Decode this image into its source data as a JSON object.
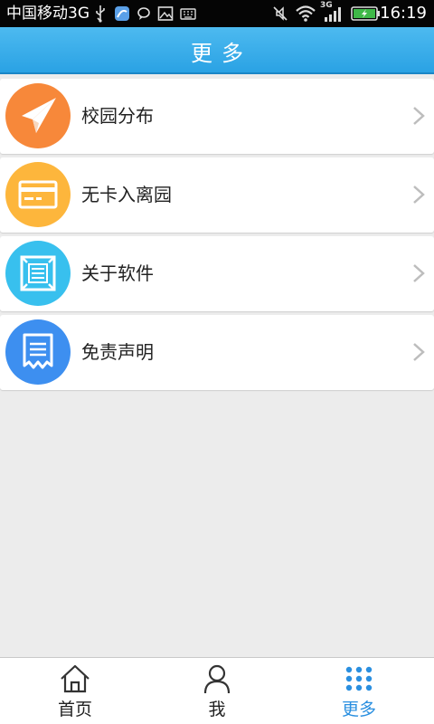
{
  "status_bar": {
    "carrier": "中国移动3G",
    "network": "3G",
    "time": "16:19"
  },
  "header": {
    "title": "更多"
  },
  "menu": {
    "items": [
      {
        "label": "校园分布",
        "icon": "paper-plane-icon",
        "color": "#f7883a"
      },
      {
        "label": "无卡入离园",
        "icon": "card-icon",
        "color": "#fdb63c"
      },
      {
        "label": "关于软件",
        "icon": "info-frame-icon",
        "color": "#38c0ee"
      },
      {
        "label": "免责声明",
        "icon": "receipt-icon",
        "color": "#3d8ff0"
      }
    ]
  },
  "tabbar": {
    "tabs": [
      {
        "label": "首页",
        "icon": "home-icon"
      },
      {
        "label": "我",
        "icon": "person-icon"
      },
      {
        "label": "更多",
        "icon": "grid-dots-icon",
        "active": true
      }
    ],
    "active_color": "#2a8fe0"
  }
}
